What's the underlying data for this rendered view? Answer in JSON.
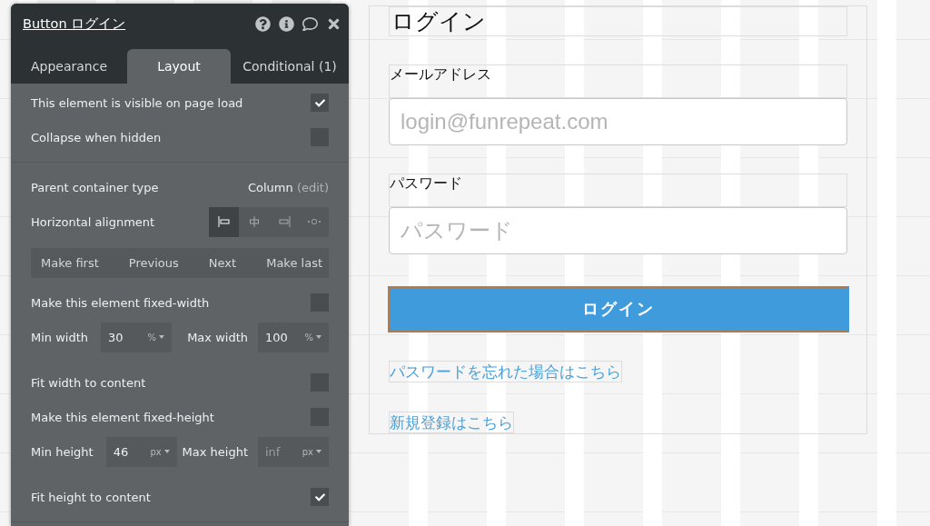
{
  "panel": {
    "title": "Button ログイン",
    "tabs": [
      {
        "label": "Appearance",
        "selected": false
      },
      {
        "label": "Layout",
        "selected": true
      },
      {
        "label": "Conditional (1)",
        "selected": false
      }
    ],
    "sections": [
      {
        "rows": [
          {
            "kind": "checkbox",
            "label": "This element is visible on page load",
            "checked": true
          },
          {
            "kind": "checkbox",
            "label": "Collapse when hidden",
            "checked": false
          }
        ]
      },
      {
        "rows": [
          {
            "kind": "value",
            "label": "Parent container type",
            "value": "Column",
            "link": "(edit)"
          },
          {
            "kind": "alignment",
            "label": "Horizontal alignment",
            "options": [
              {
                "selected": true
              },
              {
                "selected": false
              },
              {
                "selected": false
              },
              {
                "selected": false
              }
            ]
          },
          {
            "kind": "buttons",
            "buttons": [
              "Make first",
              "Previous",
              "Next",
              "Make last"
            ]
          },
          {
            "kind": "checkbox",
            "label": "Make this element fixed-width",
            "checked": false
          },
          {
            "kind": "pair",
            "fields": [
              {
                "label": "Min width",
                "value": "30",
                "unit": "%"
              },
              {
                "label": "Max width",
                "value": "100",
                "unit": "%"
              }
            ]
          },
          {
            "kind": "checkbox",
            "label": "Fit width to content",
            "checked": false
          },
          {
            "kind": "checkbox",
            "label": "Make this element fixed-height",
            "checked": false
          },
          {
            "kind": "pair",
            "fields": [
              {
                "label": "Min height",
                "value": "46",
                "unit": "px"
              },
              {
                "label": "Max height",
                "placeholder": "inf",
                "unit": "px"
              }
            ]
          },
          {
            "kind": "checkbox",
            "label": "Fit height to content",
            "checked": true
          }
        ]
      }
    ]
  },
  "page": {
    "title": "ログイン",
    "fields": [
      {
        "label": "メールアドレス",
        "placeholder": "login@funrepeat.com"
      },
      {
        "label": "パスワード",
        "placeholder": "パスワード"
      }
    ],
    "button": "ログイン",
    "links": [
      "パスワードを忘れた場合はこちら",
      "新規登録はこちら"
    ]
  }
}
